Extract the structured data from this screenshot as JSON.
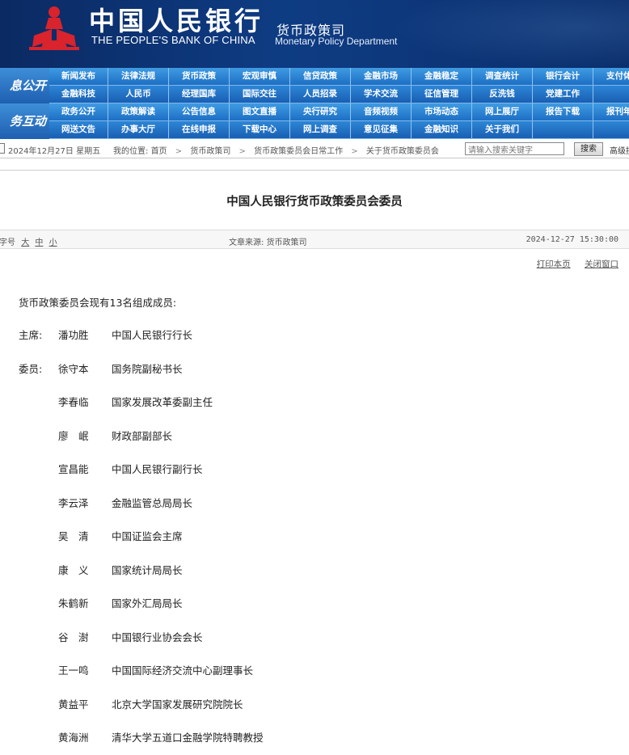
{
  "header": {
    "cn_title": "中国人民银行",
    "en_title": "THE PEOPLE'S BANK OF CHINA",
    "dept_cn": "货币政策司",
    "dept_en": "Monetary Policy Department",
    "brand_color": "#0e3c83",
    "logo_color": "#d9232d"
  },
  "nav": {
    "side_label_1": "息公开",
    "side_label_2": "务互动",
    "rows": [
      [
        "新闻发布",
        "法律法规",
        "货币政策",
        "宏观审慎",
        "信贷政策",
        "金融市场",
        "金融稳定",
        "调查统计",
        "银行会计",
        "支付体系"
      ],
      [
        "金融科技",
        "人民币",
        "经理国库",
        "国际交往",
        "人员招录",
        "学术交流",
        "征信管理",
        "反洗钱",
        "党建工作",
        ""
      ],
      [
        "政务公开",
        "政策解读",
        "公告信息",
        "图文直播",
        "央行研究",
        "音频视频",
        "市场动态",
        "网上展厅",
        "报告下载",
        "报刊年鉴"
      ],
      [
        "网送文告",
        "办事大厅",
        "在线申报",
        "下载中心",
        "网上调查",
        "意见征集",
        "金融知识",
        "关于我们",
        "",
        ""
      ]
    ]
  },
  "infobar": {
    "date": "2024年12月27日 星期五",
    "location_prefix": "我的位置:",
    "breadcrumb": [
      "首页",
      "货币政策司",
      "货币政策委员会日常工作",
      "关于货币政策委员会"
    ],
    "search_placeholder": "请输入搜索关键字",
    "search_button": "搜索",
    "advanced_search": "高级搜"
  },
  "article": {
    "title": "中国人民银行货币政策委员会委员",
    "font_size_label": "字号",
    "font_sizes": [
      "大",
      "中",
      "小"
    ],
    "source": "文章来源: 货币政策司",
    "pub_date": "2024-12-27 15:30:00",
    "print_label": "打印本页",
    "close_label": "关闭窗口",
    "intro": "货币政策委员会现有13名组成成员:",
    "members": [
      {
        "role": "主席:",
        "name": "潘功胜",
        "title": "中国人民银行行长"
      },
      {
        "role": "委员:",
        "name": "徐守本",
        "title": "国务院副秘书长"
      },
      {
        "role": "",
        "name": "李春临",
        "title": "国家发展改革委副主任"
      },
      {
        "role": "",
        "name": "廖　岷",
        "title": "财政部副部长"
      },
      {
        "role": "",
        "name": "宣昌能",
        "title": "中国人民银行副行长"
      },
      {
        "role": "",
        "name": "李云泽",
        "title": "金融监管总局局长"
      },
      {
        "role": "",
        "name": "吴　清",
        "title": "中国证监会主席"
      },
      {
        "role": "",
        "name": "康　义",
        "title": "国家统计局局长"
      },
      {
        "role": "",
        "name": "朱鹤新",
        "title": "国家外汇局局长"
      },
      {
        "role": "",
        "name": "谷　澍",
        "title": "中国银行业协会会长"
      },
      {
        "role": "",
        "name": "王一鸣",
        "title": "中国国际经济交流中心副理事长"
      },
      {
        "role": "",
        "name": "黄益平",
        "title": "北京大学国家发展研究院院长"
      },
      {
        "role": "",
        "name": "黄海洲",
        "title": "清华大学五道口金融学院特聘教授"
      }
    ]
  }
}
